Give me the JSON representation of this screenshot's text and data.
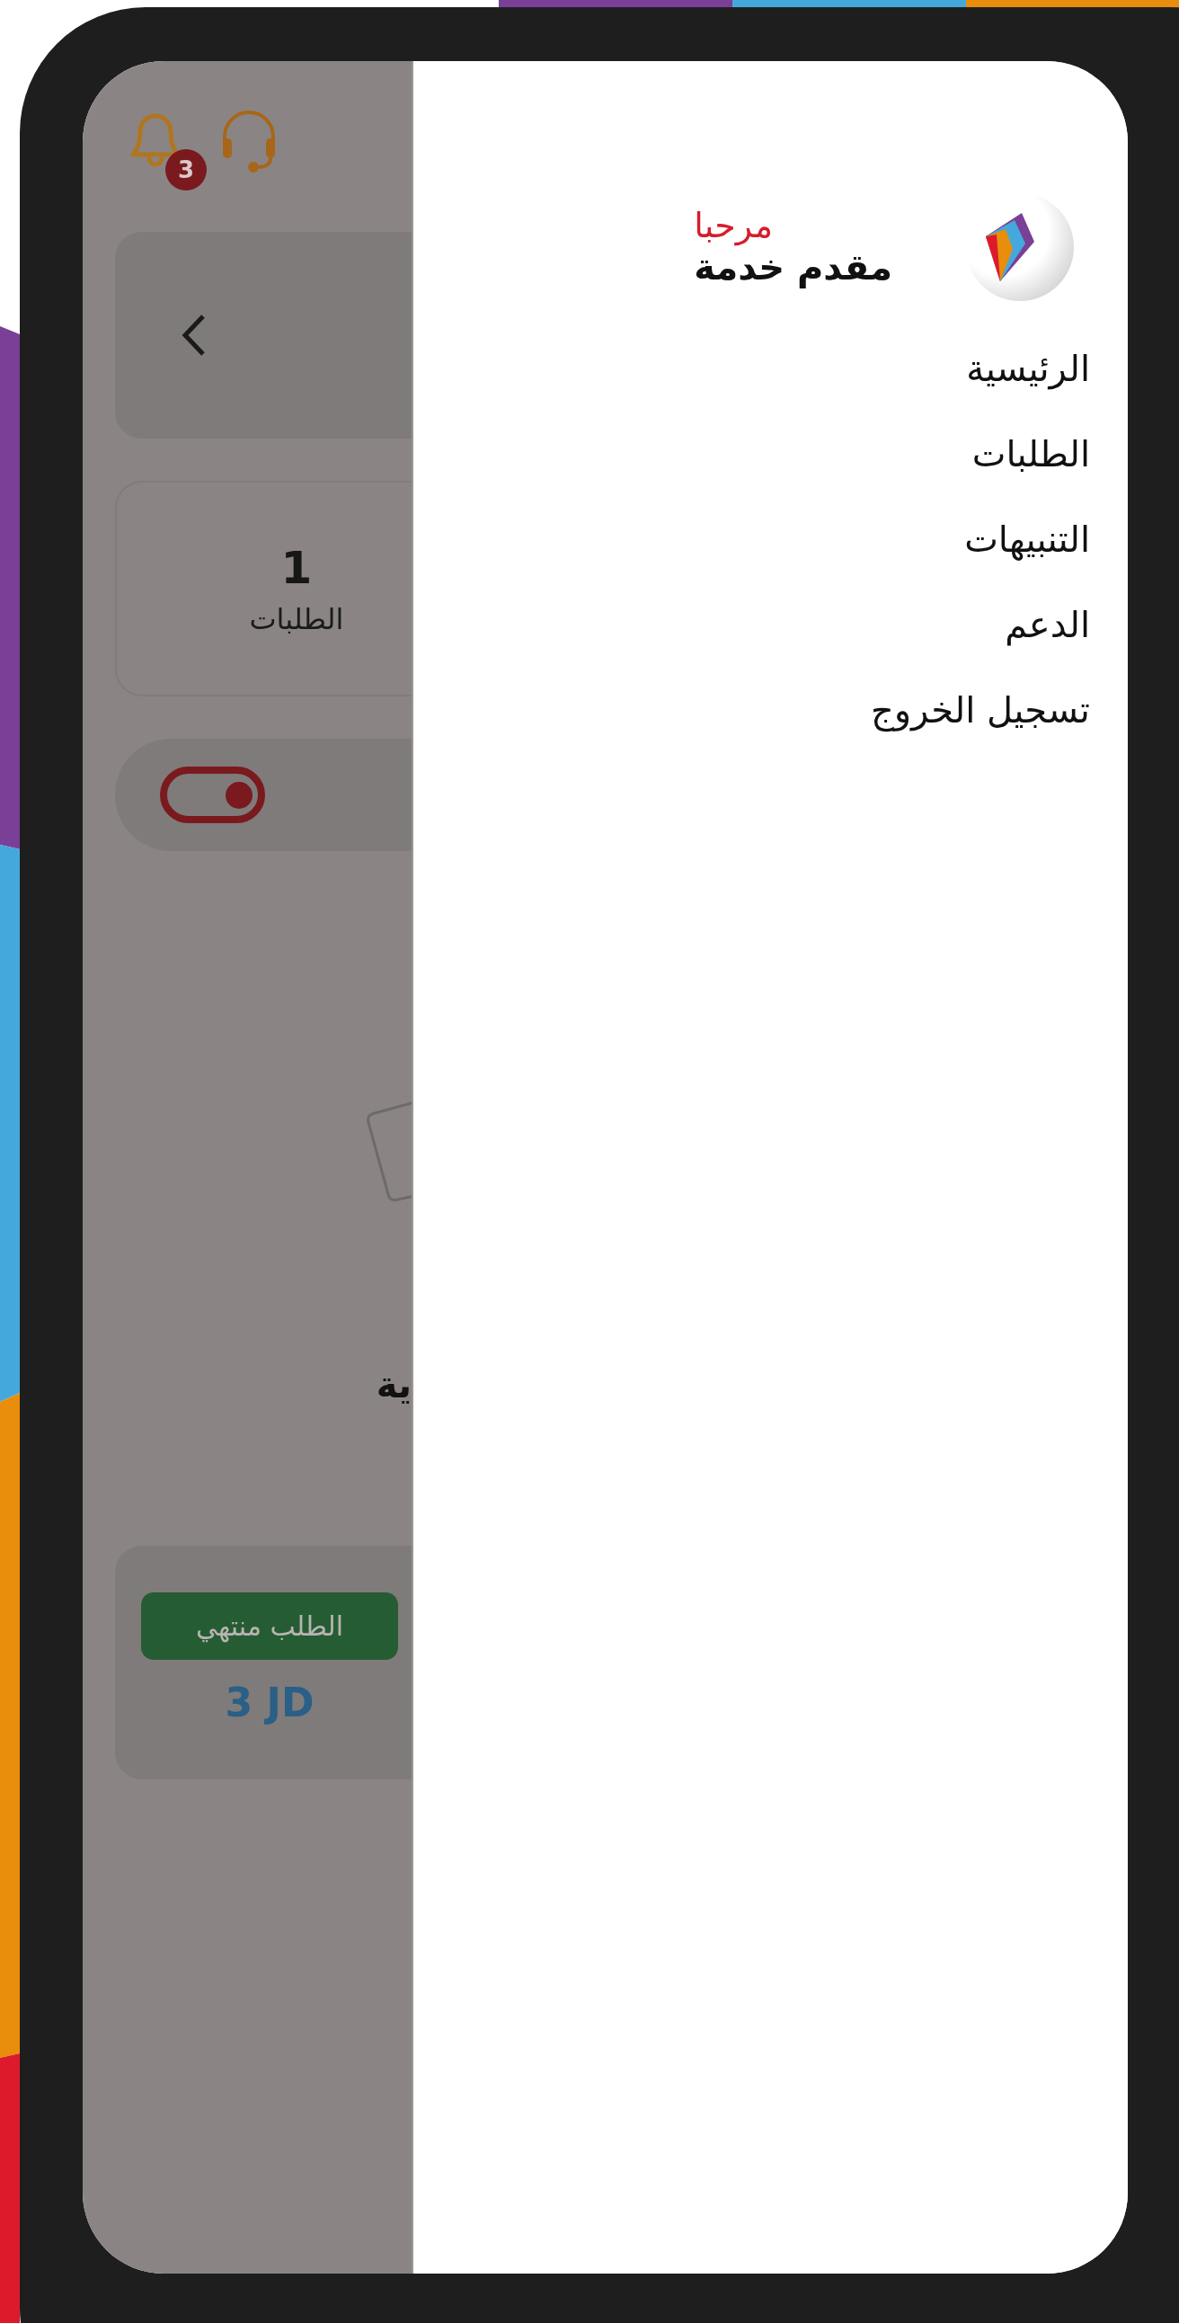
{
  "header": {
    "notification_count": "3"
  },
  "stats": [
    {
      "value": "1",
      "label": "الطلبات"
    }
  ],
  "availability_toggle": {
    "on": true
  },
  "partial_heading": "ية",
  "order_card": {
    "status": "الطلب منتهي",
    "price": "3 JD"
  },
  "drawer": {
    "greeting": "مرحبا",
    "user_role": "مقدم خدمة",
    "menu": [
      {
        "label": "الرئيسية"
      },
      {
        "label": "الطلبات"
      },
      {
        "label": "التنبيهات"
      },
      {
        "label": "الدعم"
      },
      {
        "label": "تسجيل الخروج"
      }
    ]
  }
}
